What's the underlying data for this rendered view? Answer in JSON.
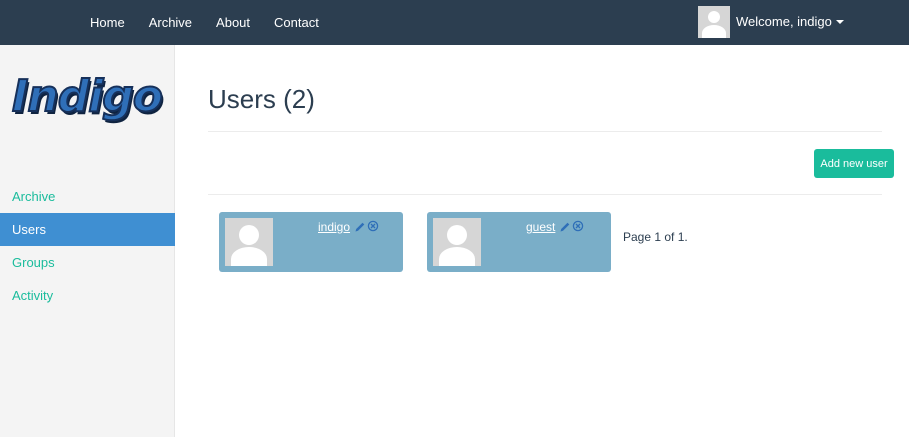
{
  "nav": {
    "links": [
      "Home",
      "Archive",
      "About",
      "Contact"
    ],
    "user_label": "Welcome, indigo"
  },
  "sidebar": {
    "logo_text": "Indigo",
    "items": [
      {
        "label": "Archive",
        "active": false
      },
      {
        "label": "Users",
        "active": true
      },
      {
        "label": "Groups",
        "active": false
      },
      {
        "label": "Activity",
        "active": false
      }
    ]
  },
  "main": {
    "title": "Users (2)",
    "add_button_label": "Add new user",
    "users": [
      {
        "name": "indigo"
      },
      {
        "name": "guest"
      }
    ],
    "pagination_text": "Page 1 of 1."
  },
  "colors": {
    "navbar": "#2c3e50",
    "accent": "#1abc9c",
    "active_nav": "#3f8fd2",
    "card": "#7aaec8"
  },
  "icons": {
    "edit": "pencil-icon",
    "delete": "remove-circle-icon",
    "avatar": "default-avatar-icon"
  }
}
